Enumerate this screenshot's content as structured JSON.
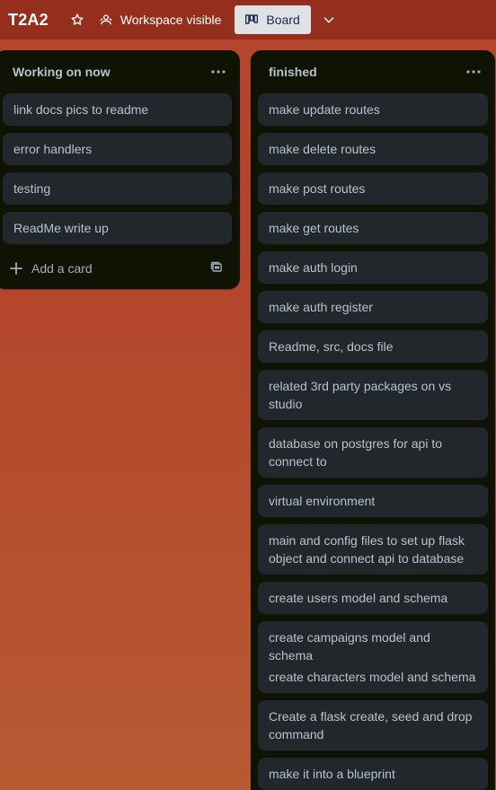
{
  "header": {
    "board_title": "T2A2",
    "visibility_label": "Workspace visible",
    "view_button_label": "Board"
  },
  "lists": [
    {
      "title": "Working on now",
      "cards": [
        "link docs pics to readme",
        "error handlers",
        "testing",
        "ReadMe write up"
      ],
      "add_card_label": "Add a card"
    },
    {
      "title": "finished",
      "cards": [
        "make update routes",
        "make delete routes",
        "make post routes",
        "make get routes",
        "make auth login",
        "make auth register",
        "Readme, src, docs file",
        "related 3rd party packages on vs studio",
        "database on postgres for api to connect to",
        "virtual environment",
        "main and config files to set up flask object and connect api to database",
        "create users model and schema",
        "create campaigns model and schema",
        "create characters model and schema",
        "Create a flask create, seed and drop command",
        "make it into a blueprint"
      ]
    }
  ],
  "icons": {
    "star": "star-icon",
    "visibility": "people-icon",
    "board": "board-icon",
    "chevron": "chevron-down-icon",
    "list_menu": "ellipsis-icon",
    "add": "plus-icon",
    "template": "template-icon"
  },
  "colors": {
    "background": "#b5452b",
    "list_bg": "#101204",
    "card_bg": "#22272b",
    "card_text": "#b6c2cf",
    "board_button_bg": "#dfe1e6"
  }
}
